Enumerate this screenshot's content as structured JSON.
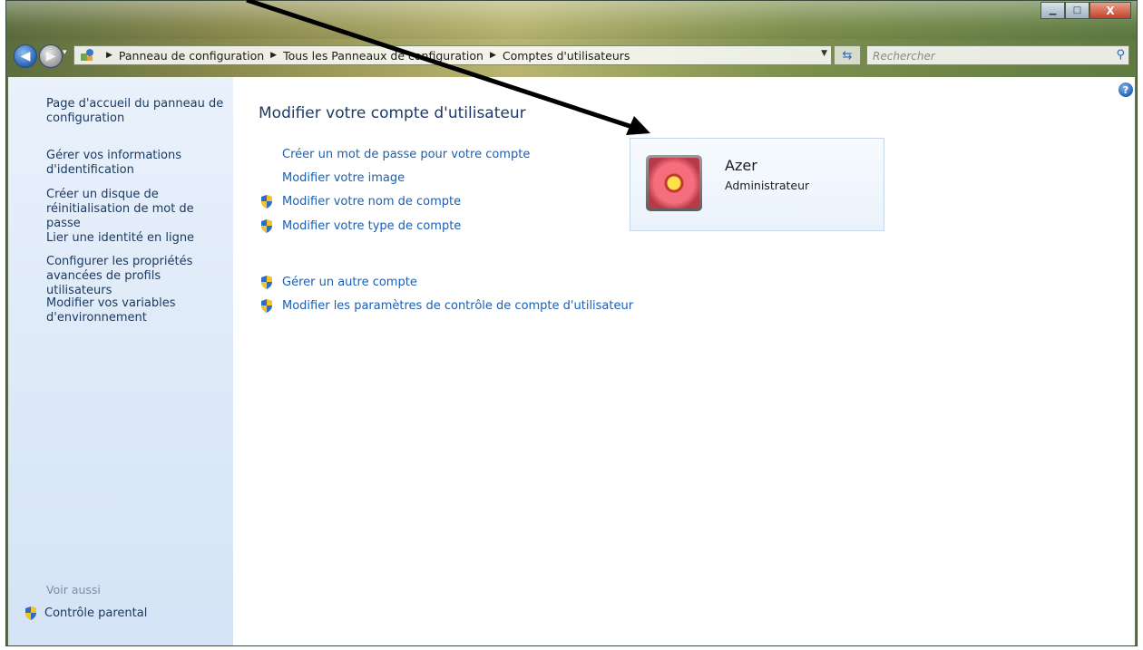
{
  "address_bar": {
    "crumbs": [
      "Panneau de configuration",
      "Tous les Panneaux de configuration",
      "Comptes d'utilisateurs"
    ]
  },
  "search": {
    "placeholder": "Rechercher"
  },
  "window_buttons": {
    "minimize": "▁",
    "maximize": "□",
    "close": "X"
  },
  "left_pane": {
    "links": [
      "Page d'accueil du panneau de configuration",
      "Gérer vos informations d'identification",
      "Créer un disque de réinitialisation de mot de passe",
      "Lier une identité en ligne",
      "Configurer les propriétés avancées de profils utilisateurs",
      "Modifier vos variables d'environnement"
    ],
    "see_also_label": "Voir aussi",
    "see_also_links": [
      "Contrôle parental"
    ]
  },
  "main": {
    "title": "Modifier votre compte d'utilisateur",
    "links": [
      "Créer un mot de passe pour votre compte",
      "Modifier votre image",
      "Modifier votre nom de compte",
      "Modifier votre type de compte"
    ],
    "other_links": [
      "Gérer un autre compte",
      "Modifier les paramètres de contrôle de compte d'utilisateur"
    ]
  },
  "account": {
    "name": "Azer",
    "type": "Administrateur"
  },
  "icons": [
    "back-arrow-icon",
    "forward-arrow-icon",
    "control-panel-icon",
    "refresh-icon",
    "search-icon",
    "help-icon",
    "uac-shield-icon",
    "account-picture-flower"
  ],
  "colors": {
    "link": "#1a5fb4",
    "title": "#1e3a6a",
    "left_pane_top": "#e9f1fb",
    "left_pane_bottom": "#d4e3f6"
  }
}
